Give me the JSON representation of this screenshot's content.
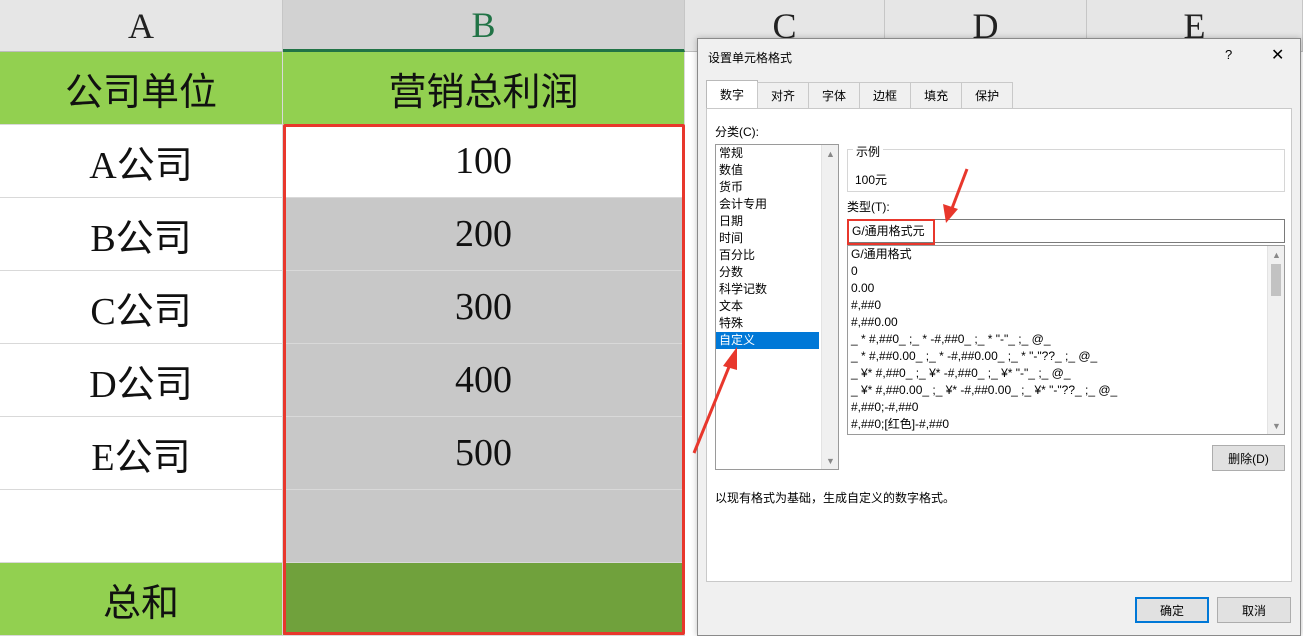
{
  "sheet": {
    "col_headers": [
      "A",
      "B",
      "C",
      "D",
      "E"
    ],
    "header_row": {
      "a": "公司单位",
      "b": "营销总利润"
    },
    "rows": [
      {
        "company": "A公司",
        "value": "100"
      },
      {
        "company": "B公司",
        "value": "200"
      },
      {
        "company": "C公司",
        "value": "300"
      },
      {
        "company": "D公司",
        "value": "400"
      },
      {
        "company": "E公司",
        "value": "500"
      }
    ],
    "total_label": "总和",
    "colors": {
      "header_green": "#92d050",
      "total_green": "#70a13c",
      "selection_gray": "#c8c8c8",
      "highlight_red": "#e8372c"
    }
  },
  "dialog": {
    "title": "设置单元格格式",
    "help": "?",
    "close": "✕",
    "tabs": [
      "数字",
      "对齐",
      "字体",
      "边框",
      "填充",
      "保护"
    ],
    "category_label": "分类(C):",
    "categories": [
      "常规",
      "数值",
      "货币",
      "会计专用",
      "日期",
      "时间",
      "百分比",
      "分数",
      "科学记数",
      "文本",
      "特殊",
      "自定义"
    ],
    "selected_category": "自定义",
    "sample_label": "示例",
    "sample_value": "100元",
    "type_label": "类型(T):",
    "type_value": "G/通用格式元",
    "formats": [
      "G/通用格式",
      "0",
      "0.00",
      "#,##0",
      "#,##0.00",
      "_ * #,##0_ ;_ * -#,##0_ ;_ * \"-\"_ ;_ @_",
      "_ * #,##0.00_ ;_ * -#,##0.00_ ;_ * \"-\"??_ ;_ @_",
      "_ ¥* #,##0_ ;_ ¥* -#,##0_ ;_ ¥* \"-\"_ ;_ @_",
      "_ ¥* #,##0.00_ ;_ ¥* -#,##0.00_ ;_ ¥* \"-\"??_ ;_ @_",
      "#,##0;-#,##0",
      "#,##0;[红色]-#,##0"
    ],
    "delete_button": "删除(D)",
    "description": "以现有格式为基础，生成自定义的数字格式。",
    "ok_button": "确定",
    "cancel_button": "取消"
  }
}
